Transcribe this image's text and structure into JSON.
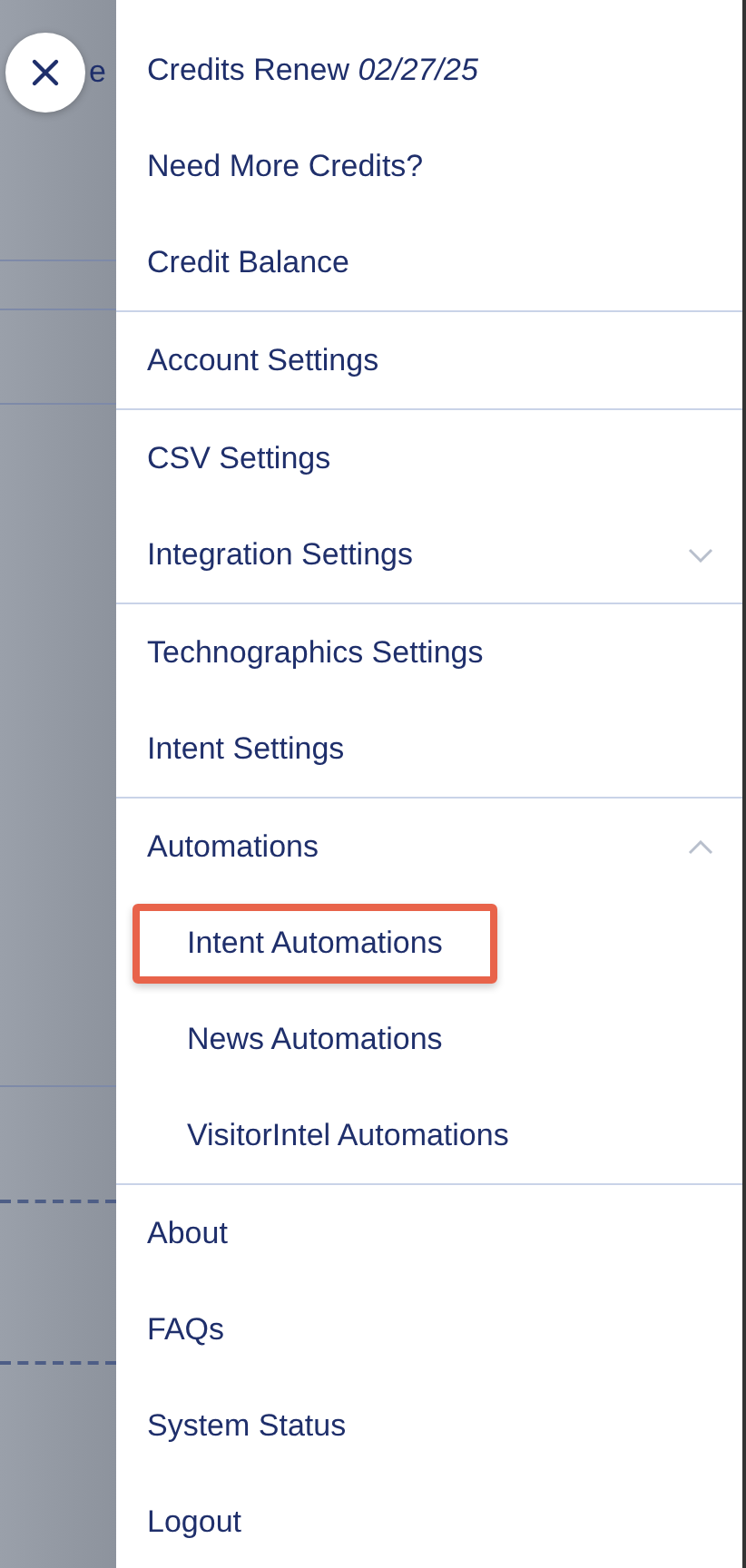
{
  "background": {
    "text": "e"
  },
  "menu": {
    "groups": [
      {
        "items": [
          {
            "label": "Credits Renew *02/27/25*"
          },
          {
            "label": "Need More Credits?"
          },
          {
            "label": "Credit Balance"
          }
        ]
      },
      {
        "items": [
          {
            "label": "Account Settings"
          }
        ]
      },
      {
        "items": [
          {
            "label": "CSV Settings"
          },
          {
            "label": "Integration Settings",
            "expanded": false
          }
        ]
      },
      {
        "items": [
          {
            "label": "Technographics Settings"
          },
          {
            "label": "Intent Settings"
          }
        ]
      },
      {
        "items": [
          {
            "label": "Automations",
            "expanded": true,
            "children": [
              {
                "label": "Intent Automations",
                "highlighted": true
              },
              {
                "label": "News Automations",
                "highlighted": false
              },
              {
                "label": "VisitorIntel Automations",
                "highlighted": false
              }
            ]
          }
        ]
      },
      {
        "items": [
          {
            "label": "About"
          },
          {
            "label": "FAQs"
          },
          {
            "label": "System Status"
          },
          {
            "label": "Logout"
          }
        ]
      }
    ]
  }
}
